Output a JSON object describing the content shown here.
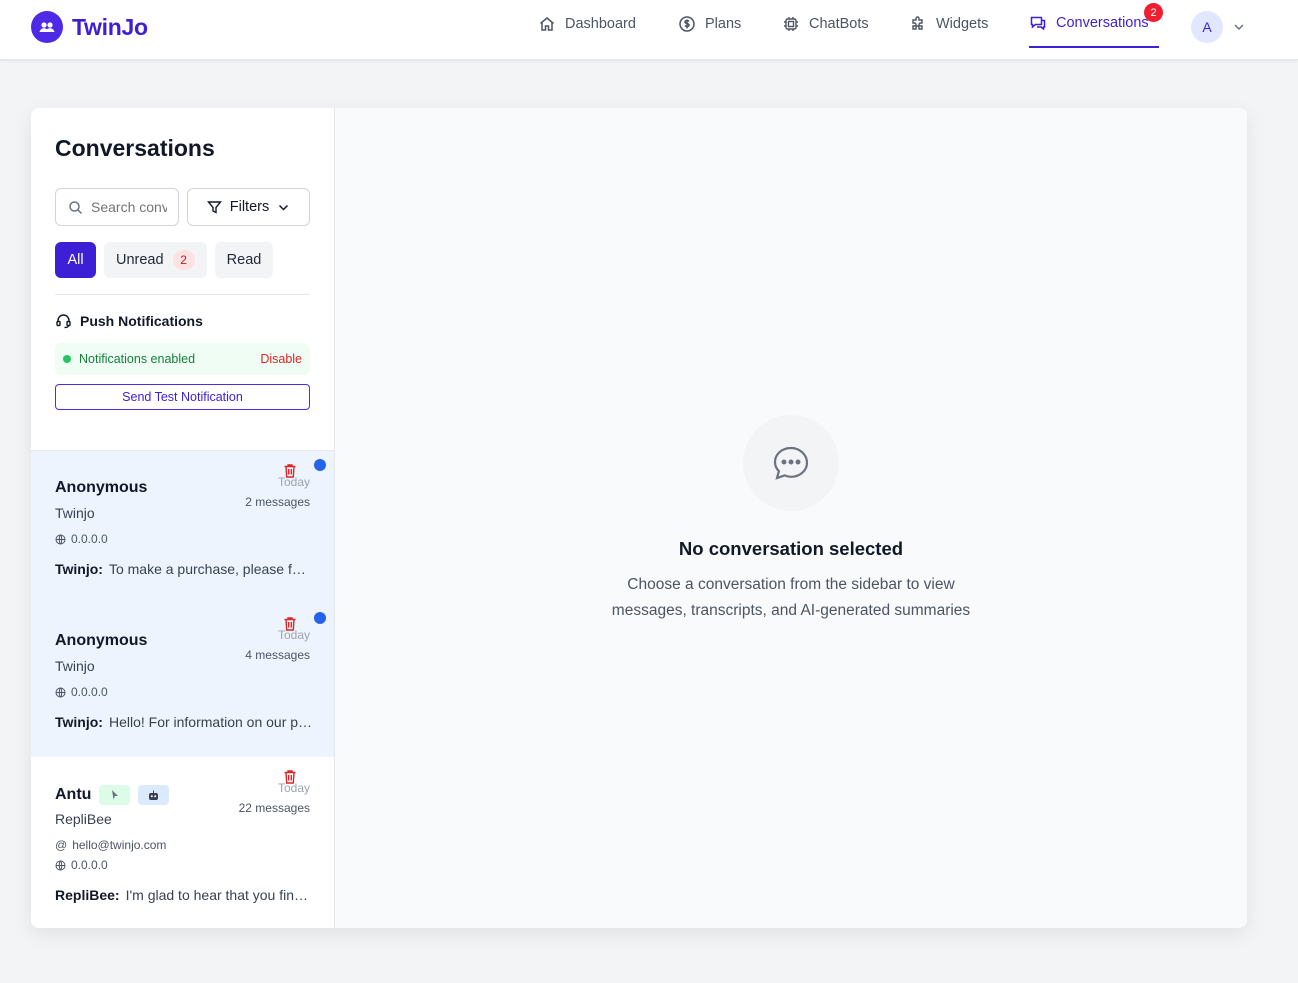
{
  "brand": {
    "name": "TwinJo",
    "accent": "#3d1fd6"
  },
  "nav": {
    "items": [
      {
        "label": "Dashboard",
        "icon": "home-icon"
      },
      {
        "label": "Plans",
        "icon": "dollar-icon"
      },
      {
        "label": "ChatBots",
        "icon": "chip-icon"
      },
      {
        "label": "Widgets",
        "icon": "puzzle-icon"
      },
      {
        "label": "Conversations",
        "icon": "chat-icon",
        "active": true,
        "badge": "2"
      }
    ],
    "avatar_initial": "A"
  },
  "sidebar": {
    "title": "Conversations",
    "search_placeholder": "Search conversations",
    "filters_label": "Filters",
    "tabs": {
      "all": "All",
      "unread": "Unread",
      "unread_count": "2",
      "read": "Read"
    },
    "push": {
      "title": "Push Notifications",
      "status": "Notifications enabled",
      "disable": "Disable",
      "test_button": "Send Test Notification"
    }
  },
  "conversations": [
    {
      "name": "Anonymous",
      "source": "Twinjo",
      "email": "",
      "ip": "0.0.0.0",
      "date": "Today",
      "count": "2 messages",
      "sender": "Twinjo:",
      "preview": "To make a purchase, please follow these steps",
      "unread": true
    },
    {
      "name": "Anonymous",
      "source": "Twinjo",
      "email": "",
      "ip": "0.0.0.0",
      "date": "Today",
      "count": "4 messages",
      "sender": "Twinjo:",
      "preview": "Hello! For information on our plans and pricing",
      "unread": true
    },
    {
      "name": "Antu",
      "source": "RepliBee",
      "email": "hello@twinjo.com",
      "ip": "0.0.0.0",
      "date": "Today",
      "count": "22 messages",
      "sender": "RepliBee:",
      "preview": "I'm glad to hear that you find it helpful",
      "unread": false
    }
  ],
  "empty_state": {
    "title": "No conversation selected",
    "description": "Choose a conversation from the sidebar to view messages, transcripts, and AI-generated summaries"
  }
}
